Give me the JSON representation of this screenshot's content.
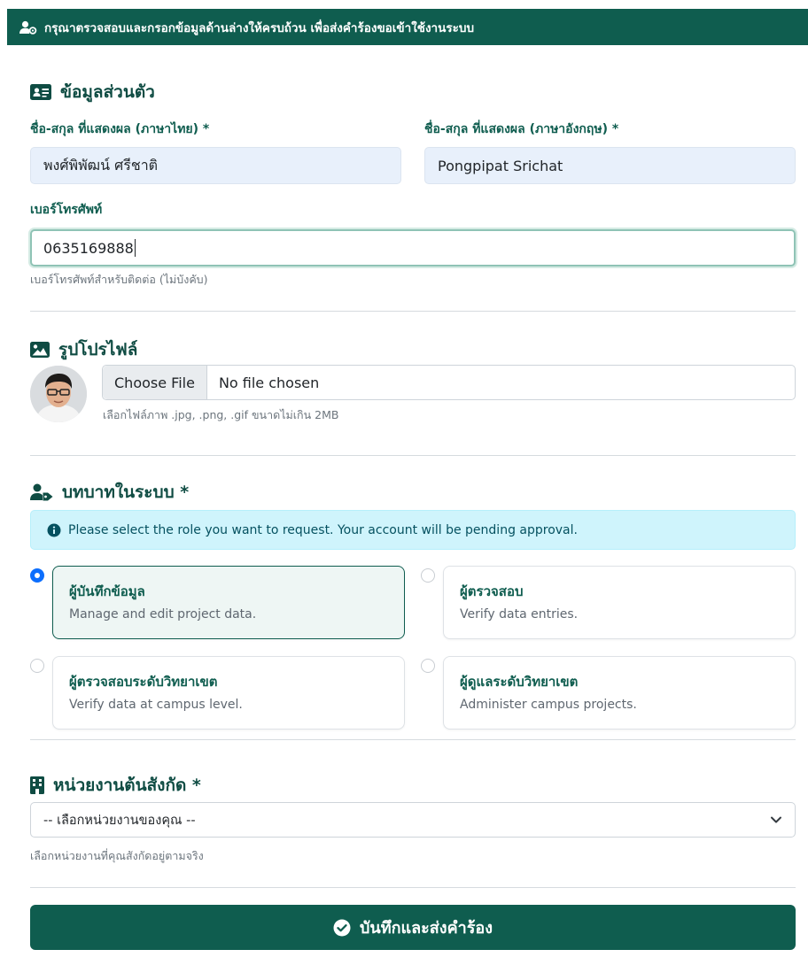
{
  "header": {
    "notice": "กรุณาตรวจสอบและกรอกข้อมูลด้านล่างให้ครบถ้วน เพื่อส่งคำร้องขอเข้าใช้งานระบบ"
  },
  "personal": {
    "title": "ข้อมูลส่วนตัว",
    "name_th_label": "ชื่อ-สกุล ที่แสดงผล (ภาษาไทย) *",
    "name_th_value": "พงศ์พิพัฒน์ ศรีชาติ",
    "name_en_label": "ชื่อ-สกุล ที่แสดงผล (ภาษาอังกฤษ) *",
    "name_en_value": "Pongpipat Srichat",
    "phone_label": "เบอร์โทรศัพท์",
    "phone_value": "0635169888",
    "phone_help": "เบอร์โทรศัพท์สำหรับติดต่อ (ไม่บังคับ)"
  },
  "profile": {
    "title": "รูปโปรไฟล์",
    "choose_file_label": "Choose File",
    "file_status": "No file chosen",
    "help": "เลือกไฟล์ภาพ .jpg, .png, .gif ขนาดไม่เกิน 2MB"
  },
  "roles": {
    "title": "บทบาทในระบบ *",
    "alert": "Please select the role you want to request. Your account will be pending approval.",
    "options": [
      {
        "title": "ผู้บันทึกข้อมูล",
        "desc": "Manage and edit project data."
      },
      {
        "title": "ผู้ตรวจสอบ",
        "desc": "Verify data entries."
      },
      {
        "title": "ผู้ตรวจสอบระดับวิทยาเขต",
        "desc": "Verify data at campus level."
      },
      {
        "title": "ผู้ดูแลระดับวิทยาเขต",
        "desc": "Administer campus projects."
      }
    ],
    "selected_index": 0
  },
  "unit": {
    "title": "หน่วยงานต้นสังกัด *",
    "select_value": "-- เลือกหน่วยงานของคุณ --",
    "help": "เลือกหน่วยงานที่คุณสังกัดอยู่ตามจริง"
  },
  "submit": {
    "label": "บันทึกและส่งคำร้อง"
  },
  "colors": {
    "primary": "#0f5d4f",
    "info_bg": "#cff4fc",
    "radio_checked": "#0d6efd"
  },
  "icons": {
    "header": "user-gear-icon",
    "personal": "id-card-icon",
    "profile": "image-icon",
    "roles": "user-tag-icon",
    "unit": "building-icon",
    "alert": "info-circle-icon",
    "select": "chevron-down-icon",
    "submit": "check-circle-icon"
  }
}
